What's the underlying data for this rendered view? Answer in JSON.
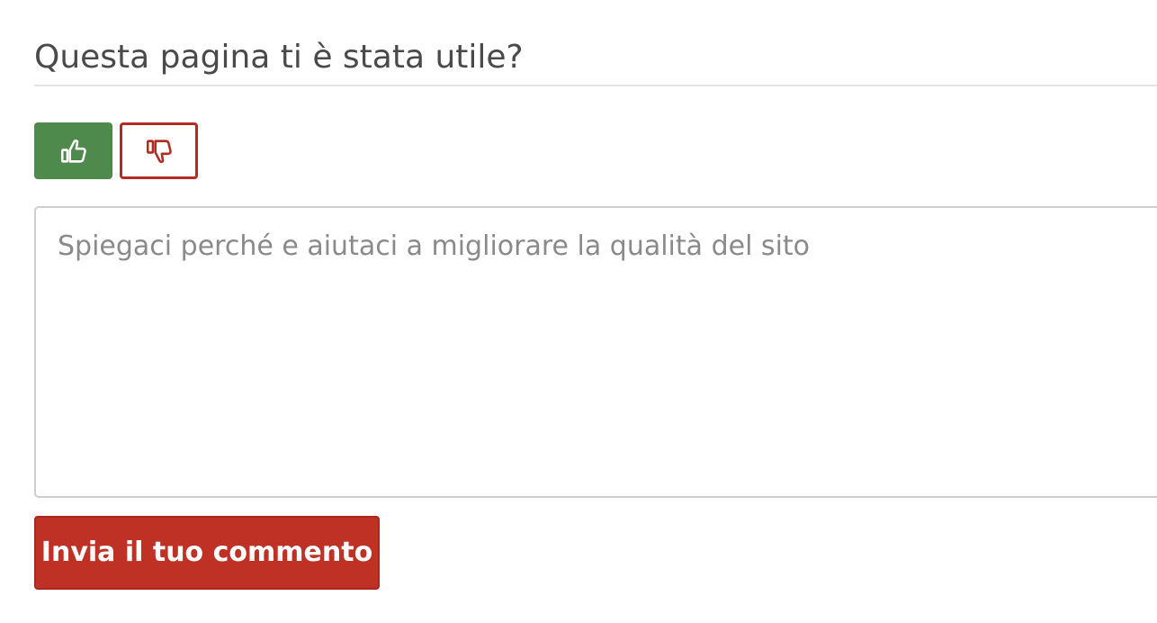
{
  "feedback": {
    "title": "Questa pagina ti è stata utile?",
    "vote_up": {
      "icon": "thumbs-up-icon",
      "state": "selected",
      "color": "#4e8a4b"
    },
    "vote_down": {
      "icon": "thumbs-down-icon",
      "state": "unselected",
      "color": "#b52b21"
    },
    "comment": {
      "placeholder": "Spiegaci perché e aiutaci a migliorare la qualità del sito",
      "value": ""
    },
    "submit_label": "Invia il tuo commento",
    "submit_color": "#bf3025"
  }
}
